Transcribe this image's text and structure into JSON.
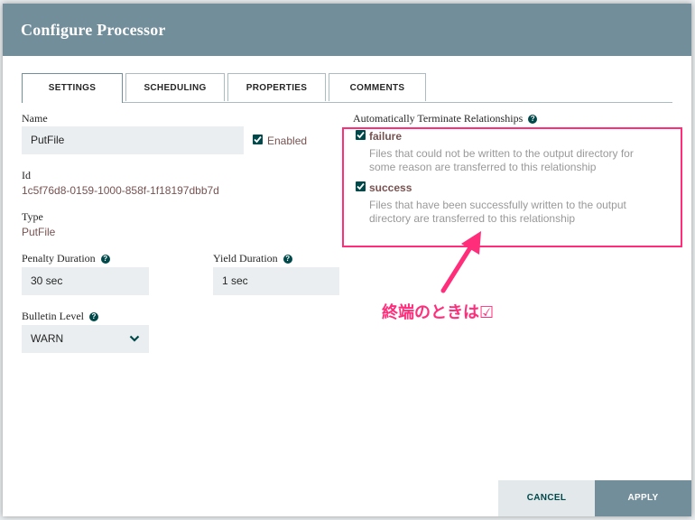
{
  "dialog": {
    "title": "Configure Processor"
  },
  "tabs": [
    {
      "label": "SETTINGS"
    },
    {
      "label": "SCHEDULING"
    },
    {
      "label": "PROPERTIES"
    },
    {
      "label": "COMMENTS"
    }
  ],
  "settings": {
    "name_label": "Name",
    "name_value": "PutFile",
    "enabled_label": "Enabled",
    "id_label": "Id",
    "id_value": "1c5f76d8-0159-1000-858f-1f18197dbb7d",
    "type_label": "Type",
    "type_value": "PutFile",
    "penalty_label": "Penalty Duration",
    "penalty_value": "30 sec",
    "yield_label": "Yield Duration",
    "yield_value": "1 sec",
    "bulletin_label": "Bulletin Level",
    "bulletin_value": "WARN",
    "help_glyph": "?"
  },
  "relationships": {
    "title": "Automatically Terminate Relationships",
    "items": [
      {
        "name": "failure",
        "checked": true,
        "description_1": "Files that could not be written to the output directory for",
        "description_2": "some reason are transferred to this relationship"
      },
      {
        "name": "success",
        "checked": true,
        "description_1": "Files that have been successfully written to the output",
        "description_2": "directory are transferred to this relationship"
      }
    ]
  },
  "annotation": {
    "text": "終端のときは☑"
  },
  "footer": {
    "cancel_label": "CANCEL",
    "apply_label": "APPLY"
  },
  "colors": {
    "header": "#728e9b",
    "accent": "#004849",
    "link": "#775351",
    "annotation": "#ff2d7a"
  },
  "icons": {
    "help": "help-circle-icon",
    "checkbox": "check-icon",
    "dropdown": "chevron-down-icon"
  }
}
